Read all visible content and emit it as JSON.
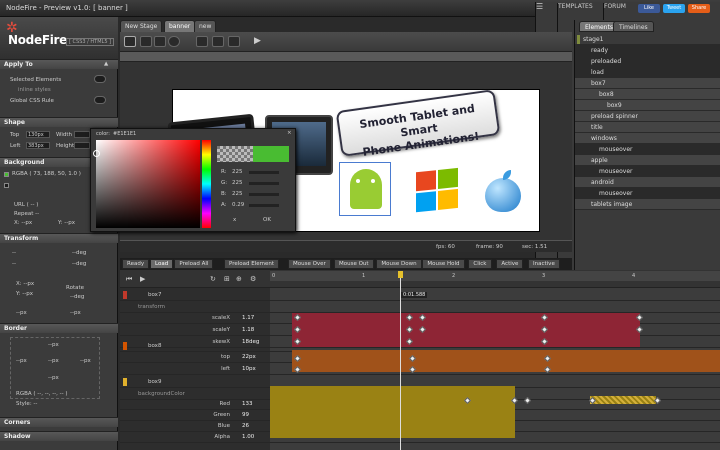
{
  "app": {
    "title": "NodeFire - Preview v1.0: [ banner ]",
    "templates": "TEMPLATES",
    "forum": "FORUM",
    "like": "Like",
    "tweet": "Tweet",
    "share": "Share"
  },
  "logo": {
    "name": "NodeFire",
    "sub": "[ CSS3 / HTML5 ]"
  },
  "left_panel": {
    "apply_to": {
      "header": "Apply To",
      "selected": "Selected Elements",
      "inline": "inline styles",
      "global": "Global CSS Rule"
    },
    "shape": {
      "header": "Shape",
      "top_label": "Top",
      "top_val": "130px",
      "width_label": "Width",
      "left_label": "Left",
      "left_val": "383px",
      "height_label": "Height"
    },
    "background": {
      "header": "Background",
      "rgba": "RGBA ( 73, 188, 50, 1.0 )",
      "url": "URL ( -- )",
      "repeat": "Repeat --",
      "x": "X: --px",
      "y": "Y: --px"
    },
    "transform": {
      "header": "Transform",
      "v1": "--",
      "v2": "--deg",
      "v3": "--",
      "v4": "--deg",
      "x": "X: --px",
      "y": "Y: --px",
      "rotate": "Rotate",
      "deg": "--deg",
      "v5": "--px",
      "v6": "--px"
    },
    "border": {
      "header": "Border",
      "px": "--px",
      "rgba": "RGBA ( --, --, --, -- )",
      "style": "Style: --"
    },
    "corners": {
      "header": "Corners"
    },
    "shadow": {
      "header": "Shadow"
    }
  },
  "tabs": [
    {
      "label": "New Stage"
    },
    {
      "label": "banner"
    },
    {
      "label": "new"
    }
  ],
  "stage": {
    "banner_line1": "Smooth Tablet and Smart",
    "banner_line2": "Phone Animations!",
    "fps_label": "fps: 60",
    "frame_label": "frame: 90",
    "sec_label": "sec: 1.51"
  },
  "picker": {
    "color_label": "color:",
    "color_val": "#E1E1E1",
    "r_label": "R:",
    "r_val": "225",
    "g_label": "G:",
    "g_val": "225",
    "b_label": "B:",
    "b_val": "225",
    "a_label": "A:",
    "a_val": "0.29",
    "ok": "OK",
    "cancel": "x"
  },
  "right_panel": {
    "tabs": [
      {
        "label": "Elements"
      },
      {
        "label": "Timelines"
      }
    ],
    "items": [
      {
        "label": "stage1",
        "indent": 0,
        "color": "",
        "style": "header"
      },
      {
        "label": "ready",
        "indent": 1,
        "color": "",
        "style": "dark"
      },
      {
        "label": "preloaded",
        "indent": 1,
        "color": "",
        "style": "dark"
      },
      {
        "label": "load",
        "indent": 1,
        "color": "",
        "style": "dark"
      },
      {
        "label": "box7",
        "indent": 1,
        "color": "#c0392b",
        "style": "mid"
      },
      {
        "label": "box8",
        "indent": 2,
        "color": "#d35400",
        "style": "mid"
      },
      {
        "label": "box9",
        "indent": 3,
        "color": "#e1b12c",
        "style": "mid"
      },
      {
        "label": "preload spinner",
        "indent": 1,
        "color": "#27ae60",
        "style": "mid"
      },
      {
        "label": "title",
        "indent": 1,
        "color": "#2980b9",
        "style": "mid"
      },
      {
        "label": "windows",
        "indent": 1,
        "color": "#8e44ad",
        "style": "mid"
      },
      {
        "label": "mouseover",
        "indent": 2,
        "color": "",
        "style": "dark"
      },
      {
        "label": "apple",
        "indent": 1,
        "color": "#16a085",
        "style": "mid"
      },
      {
        "label": "mouseover",
        "indent": 2,
        "color": "",
        "style": "dark"
      },
      {
        "label": "android",
        "indent": 1,
        "color": "#9b59b6",
        "style": "mid"
      },
      {
        "label": "mouseover",
        "indent": 2,
        "color": "",
        "style": "dark"
      },
      {
        "label": "tablets image",
        "indent": 1,
        "color": "#7f8c3d",
        "style": "mid"
      }
    ]
  },
  "timeline": {
    "tabs": [
      "Ready",
      "Load",
      "Preload All",
      "Preload Element",
      "Mouse Over",
      "Mouse Out",
      "Mouse Down",
      "Mouse Hold",
      "Click",
      "Active",
      "Inactive"
    ],
    "active_tab": "Load",
    "time_readout": "0:01.588",
    "ruler": [
      "0",
      "1",
      "2",
      "3",
      "4",
      "5"
    ],
    "tracks": [
      {
        "name": "box7",
        "color": "#c0392b",
        "sub": "transform",
        "props": [
          {
            "name": "scaleX",
            "val": "1.17"
          },
          {
            "name": "scaleY",
            "val": "1.18"
          },
          {
            "name": "skewX",
            "val": "18deg"
          }
        ]
      },
      {
        "name": "box8",
        "color": "#d35400",
        "sub": "",
        "props": [
          {
            "name": "top",
            "val": "22px"
          },
          {
            "name": "left",
            "val": "10px"
          }
        ]
      },
      {
        "name": "box9",
        "color": "#e1b12c",
        "sub": "backgroundColor",
        "props": [
          {
            "name": "Red",
            "val": "133"
          },
          {
            "name": "Green",
            "val": "99"
          },
          {
            "name": "Blue",
            "val": "26"
          },
          {
            "name": "Alpha",
            "val": "1.00"
          }
        ]
      }
    ]
  }
}
